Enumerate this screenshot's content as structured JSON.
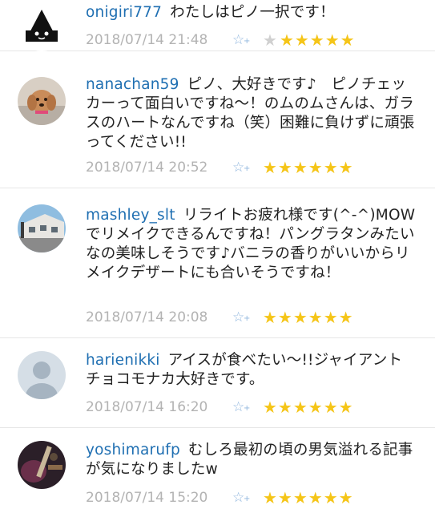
{
  "comments": [
    {
      "username": "onigiri777",
      "text": "わたしはピノ一択です！",
      "timestamp": "2018/07/14 21:48",
      "star_icon": "star-add-icon",
      "grey_star": "★",
      "stars": "★★★★★"
    },
    {
      "username": "nanachan59",
      "text": "ピノ、大好きです♪　ピノチェッカーって面白いですね〜！のムのムさんは、ガラスのハートなんですね（笑）困難に負けずに頑張ってください!!",
      "timestamp": "2018/07/14 20:52",
      "star_icon": "star-add-icon",
      "stars": "★★★★★★"
    },
    {
      "username": "mashley_slt",
      "text": "リライトお疲れ様です(^-^)MOWでリメイクできるんですね！パングラタンみたいなの美味しそうです♪バニラの香りがいいからリメイクデザートにも合いそうですね！",
      "timestamp": "2018/07/14 20:08",
      "star_icon": "star-add-icon",
      "stars": "★★★★★★"
    },
    {
      "username": "harienikki",
      "text": "アイスが食べたい〜!!ジャイアントチョコモナカ大好きです。",
      "timestamp": "2018/07/14 16:20",
      "star_icon": "star-add-icon",
      "stars": "★★★★★★"
    },
    {
      "username": "yoshimarufp",
      "text": "むしろ最初の頃の男気溢れる記事が気になりましたw",
      "timestamp": "2018/07/14 15:20",
      "star_icon": "star-add-icon",
      "stars": "★★★★★★"
    }
  ]
}
